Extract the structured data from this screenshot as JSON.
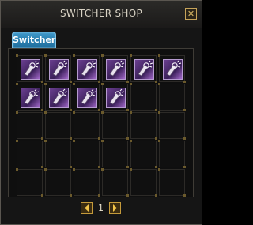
{
  "window": {
    "title": "SWITCHER SHOP",
    "close_icon": "close-icon"
  },
  "tab": {
    "label": "Switcher"
  },
  "grid": {
    "slots": [
      {
        "item": "switcher-scroll-icon"
      },
      {
        "item": "switcher-scroll-icon"
      },
      {
        "item": "switcher-scroll-icon"
      },
      {
        "item": "switcher-scroll-icon"
      },
      {
        "item": "switcher-scroll-icon"
      },
      {
        "item": "switcher-scroll-icon"
      },
      {
        "item": "switcher-scroll-icon"
      },
      {
        "item": "switcher-scroll-icon"
      },
      {
        "item": "switcher-scroll-icon"
      },
      {
        "item": "switcher-scroll-icon"
      },
      {
        "item": null
      },
      {
        "item": null
      },
      {
        "item": null
      },
      {
        "item": null
      },
      {
        "item": null
      },
      {
        "item": null
      },
      {
        "item": null
      },
      {
        "item": null
      },
      {
        "item": null
      },
      {
        "item": null
      },
      {
        "item": null
      },
      {
        "item": null
      },
      {
        "item": null
      },
      {
        "item": null
      },
      {
        "item": null
      },
      {
        "item": null
      },
      {
        "item": null
      },
      {
        "item": null
      },
      {
        "item": null
      },
      {
        "item": null
      }
    ]
  },
  "pager": {
    "page": "1",
    "prev_icon": "left-arrow-icon",
    "next_icon": "right-arrow-icon"
  }
}
